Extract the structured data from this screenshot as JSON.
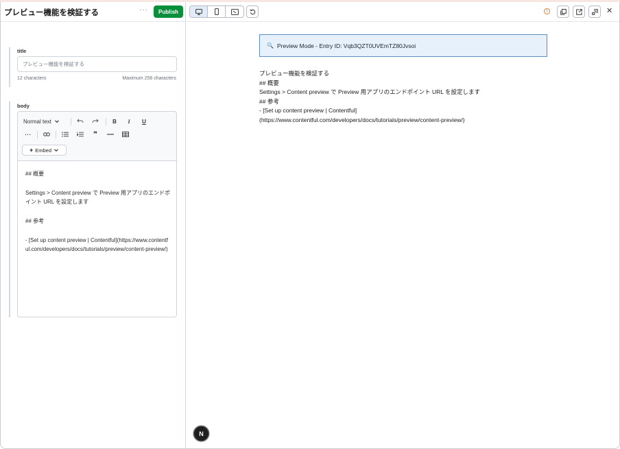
{
  "entry": {
    "title": "プレビュー機能を検証する",
    "more_label": "···",
    "publish_label": "Publish"
  },
  "fields": {
    "title": {
      "label": "title",
      "value": "プレビュー機能を検証する",
      "char_count": "12 characters",
      "max_chars": "Maximum 256 characters"
    },
    "body": {
      "label": "body",
      "toolbar": {
        "format_select": "Normal text",
        "embed_label": "Embed"
      },
      "paragraphs": [
        "## 概要",
        "Settings > Content preview で Preview 用アプリのエンドポイント URL を設定します",
        "## 参考",
        "- [Set up content preview | Contentful](https://www.contentful.com/developers/docs/tutorials/preview/content-preview/)"
      ]
    }
  },
  "preview": {
    "banner_icon": "🔍",
    "banner": "Preview Mode - Entry ID: Vqb3QZT0UVEmTZ80Jvsoi",
    "lines": [
      "プレビュー機能を検証する",
      "## 概要",
      "Settings > Content preview で Preview 用アプリのエンドポイント URL を設定します",
      "## 参考",
      "- [Set up content preview | Contentful]",
      "(https://www.contentful.com/developers/docs/tutorials/preview/content-preview/)"
    ]
  },
  "icons": {
    "desktop": "desktop-icon",
    "mobile": "mobile-icon",
    "tablet": "tablet-rotate-icon",
    "refresh": "refresh-icon",
    "warning": "warning-icon",
    "duplicate": "duplicate-icon",
    "open_external": "external-link-icon",
    "dock": "dock-icon",
    "close": "close-icon",
    "next": "N"
  },
  "colors": {
    "publish": "#0a8f3b",
    "banner_bg": "#e6f1fb",
    "banner_border": "#5a8fc0",
    "warning": "#e5792b",
    "active_device": "#e1ecf8"
  }
}
